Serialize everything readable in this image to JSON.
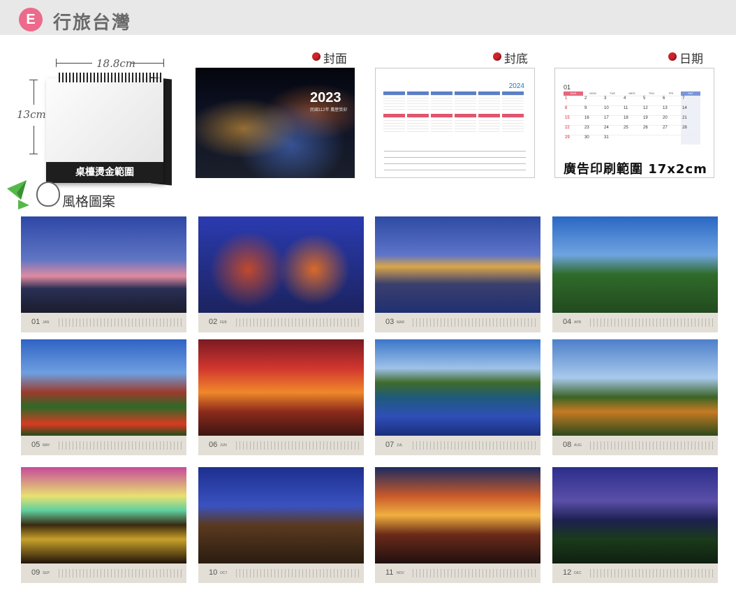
{
  "header": {
    "badge": "E",
    "title": "行旅台灣"
  },
  "product": {
    "width_label": "18.8cm",
    "height_label": "13cm",
    "desk_label": "桌檯燙金範圍"
  },
  "style_section": {
    "label": "風格圖案"
  },
  "previews": [
    {
      "label": "封面"
    },
    {
      "label": "封底"
    },
    {
      "label": "日期"
    }
  ],
  "cover": {
    "year": "2023",
    "subtitle": "民國112年 農歷癸卯"
  },
  "back": {
    "year": "2024"
  },
  "date_panel": {
    "month": "01",
    "ad_text": "廣告印刷範圍 17x2cm",
    "weekdays": [
      "SUN",
      "MON",
      "TUE",
      "WED",
      "THU",
      "FRI",
      "SAT"
    ],
    "days": [
      "1",
      "2",
      "3",
      "4",
      "5",
      "6",
      "7",
      "8",
      "9",
      "10",
      "11",
      "12",
      "13",
      "14",
      "15",
      "16",
      "17",
      "18",
      "19",
      "20",
      "21",
      "22",
      "23",
      "24",
      "25",
      "26",
      "27",
      "28",
      "29",
      "30",
      "31",
      "",
      "",
      "",
      ""
    ]
  },
  "months": [
    {
      "num": "01",
      "name": "JAN"
    },
    {
      "num": "02",
      "name": "FEB"
    },
    {
      "num": "03",
      "name": "MAR"
    },
    {
      "num": "04",
      "name": "APR"
    },
    {
      "num": "05",
      "name": "MAY"
    },
    {
      "num": "06",
      "name": "JUN"
    },
    {
      "num": "07",
      "name": "JUL"
    },
    {
      "num": "08",
      "name": "AUG"
    },
    {
      "num": "09",
      "name": "SEP"
    },
    {
      "num": "10",
      "name": "OCT"
    },
    {
      "num": "11",
      "name": "NOV"
    },
    {
      "num": "12",
      "name": "DEC"
    }
  ],
  "colors": {
    "badge": "#ec6a8c",
    "accent_red": "#d1232a",
    "header_bg": "#e8e8e8",
    "strip_bg": "#e3dfd6"
  },
  "icons": [
    "paper-plane-icon",
    "girl-face-icon",
    "red-dot-icon"
  ]
}
